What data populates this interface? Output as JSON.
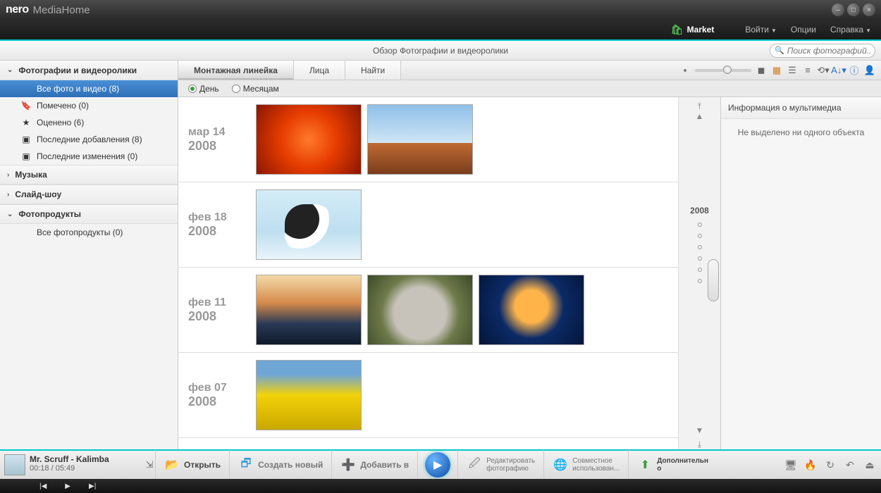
{
  "app": {
    "logo": "nero",
    "sub": "MediaHome"
  },
  "window": {
    "min": "–",
    "max": "□",
    "close": "×"
  },
  "menu": {
    "market": "Market",
    "login": "Войти",
    "options": "Опции",
    "help": "Справка"
  },
  "overview": {
    "title": "Обзор Фотографии и видеоролики"
  },
  "search": {
    "placeholder": "Поиск фотографий..."
  },
  "sidebar": {
    "sections": [
      {
        "label": "Фотографии и видеоролики",
        "open": true,
        "items": [
          {
            "label": "Все фото и видео (8)",
            "icon": "",
            "active": true
          },
          {
            "label": "Помечено (0)",
            "icon": "🔖"
          },
          {
            "label": "Оценено (6)",
            "icon": "★"
          },
          {
            "label": "Последние добавления (8)",
            "icon": "▣"
          },
          {
            "label": "Последние изменения (0)",
            "icon": "▣"
          }
        ]
      },
      {
        "label": "Музыка",
        "open": false,
        "items": []
      },
      {
        "label": "Слайд-шоу",
        "open": false,
        "items": []
      },
      {
        "label": "Фотопродукты",
        "open": true,
        "items": [
          {
            "label": "Все фотопродукты (0)",
            "icon": ""
          }
        ]
      }
    ]
  },
  "tabs": {
    "t0": "Монтажная линейка",
    "t1": "Лица",
    "t2": "Найти",
    "active": 0
  },
  "groupBy": {
    "day": "День",
    "month": "Месяцам",
    "selected": "day"
  },
  "timeline": {
    "year": "2008"
  },
  "groups": [
    {
      "d1": "мар 14",
      "d2": "2008",
      "thumbs": [
        "th-flower",
        "th-desert"
      ]
    },
    {
      "d1": "фев 18",
      "d2": "2008",
      "thumbs": [
        "th-penguin"
      ]
    },
    {
      "d1": "фев 11",
      "d2": "2008",
      "thumbs": [
        "th-light",
        "th-koala",
        "th-jelly"
      ]
    },
    {
      "d1": "фев 07",
      "d2": "2008",
      "thumbs": [
        "th-tulip"
      ]
    }
  ],
  "info": {
    "header": "Информация о мультимедиа",
    "empty": "Не выделено ни одного объекта"
  },
  "actions": {
    "open": "Открыть",
    "create": "Создать новый",
    "add": "Добавить в",
    "edit1": "Редактировать",
    "edit2": "фотографию",
    "share1": "Совместное",
    "share2": "использован...",
    "more1": "Дополнительн",
    "more2": "о"
  },
  "nowplaying": {
    "title": "Mr. Scruff - Kalimba",
    "time": "00:18 / 05:49"
  },
  "status_icons": {
    "monitor": "🖥",
    "fire": "🔥",
    "reload": "↻",
    "undo": "↶",
    "eject": "⏏"
  }
}
